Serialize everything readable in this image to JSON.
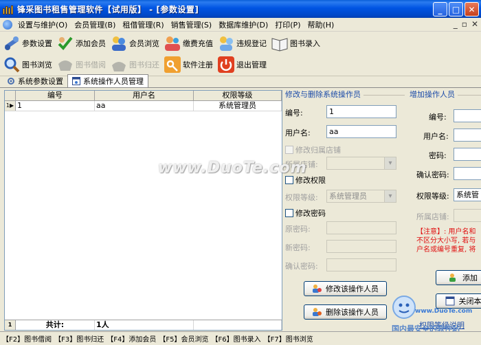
{
  "window": {
    "title": "锋采图书租售管理软件【试用版】 - [参数设置]",
    "controls": [
      "_",
      "□",
      "✕"
    ]
  },
  "menu": {
    "items": [
      "设置与维护(O)",
      "会员管理(B)",
      "租借管理(R)",
      "销售管理(S)",
      "数据库维护(D)",
      "打印(P)",
      "帮助(H)"
    ],
    "mdi_controls": [
      "_",
      "▫",
      "✕"
    ]
  },
  "toolbar1": [
    {
      "label": "参数设置",
      "icon": "wrench-settings-icon",
      "enabled": true
    },
    {
      "label": "添加会员",
      "icon": "add-member-icon",
      "enabled": true
    },
    {
      "label": "会员浏览",
      "icon": "members-icon",
      "enabled": true
    },
    {
      "label": "缴费充值",
      "icon": "recharge-icon",
      "enabled": true
    },
    {
      "label": "违规登记",
      "icon": "violation-icon",
      "enabled": true
    },
    {
      "label": "图书录入",
      "icon": "book-entry-icon",
      "enabled": true
    }
  ],
  "toolbar2": [
    {
      "label": "图书浏览",
      "icon": "magnifier-icon",
      "enabled": true
    },
    {
      "label": "图书借阅",
      "icon": "borrow-icon",
      "enabled": false
    },
    {
      "label": "图书归还",
      "icon": "return-icon",
      "enabled": false
    },
    {
      "label": "软件注册",
      "icon": "key-icon",
      "enabled": true
    },
    {
      "label": "退出管理",
      "icon": "power-icon",
      "enabled": true
    }
  ],
  "tabs": [
    {
      "label": "系统参数设置",
      "active": false
    },
    {
      "label": "系统操作人员管理",
      "active": true
    }
  ],
  "grid": {
    "headers": [
      "编号",
      "用户名",
      "权限等级"
    ],
    "rows": [
      {
        "indicator": "1▶",
        "id": "1",
        "username": "aa",
        "level": "系统管理员"
      }
    ],
    "footer": {
      "index": "1",
      "label": "共计:",
      "count": "1人"
    }
  },
  "edit_panel": {
    "title": "修改与删除系统操作员",
    "id_label": "编号:",
    "id_value": "1",
    "username_label": "用户名:",
    "username_value": "aa",
    "modify_store_label": "修改归属店铺",
    "store_label": "所属店铺:",
    "modify_perm_label": "修改权限",
    "perm_label": "权限等级:",
    "perm_value": "系统管理员",
    "modify_pwd_label": "修改密码",
    "old_pwd_label": "原密码:",
    "new_pwd_label": "新密码:",
    "confirm_pwd_label": "确认密码:",
    "modify_button": "修改该操作人员",
    "delete_button": "删除该操作人员"
  },
  "add_panel": {
    "title": "增加操作人员",
    "id_label": "编号:",
    "username_label": "用户名:",
    "password_label": "密码:",
    "confirm_label": "确认密码:",
    "level_label": "权限等级:",
    "level_value": "系统管",
    "store_label": "所属店铺:",
    "notice_1": "【注意】: 用户名和",
    "notice_2": "不区分大小写, 若与",
    "notice_3": "户名或编号重复, 将",
    "add_button": "添加",
    "close_button": "关闭本",
    "help_link": "权限等级说明"
  },
  "watermark": {
    "main": "www.DuoTe.com",
    "sub": "www.DuoTe.com",
    "cn": "国内最安全的软件站"
  },
  "statusbar": [
    "【F2】图书借阅",
    "【F3】图书归还",
    "【F4】添加会员",
    "【F5】会员浏览",
    "【F6】图书录入",
    "【F7】图书浏览"
  ],
  "colors": {
    "titlebar": "#0054e3",
    "panel_title": "#1a4aa8",
    "notice": "#e01010"
  }
}
